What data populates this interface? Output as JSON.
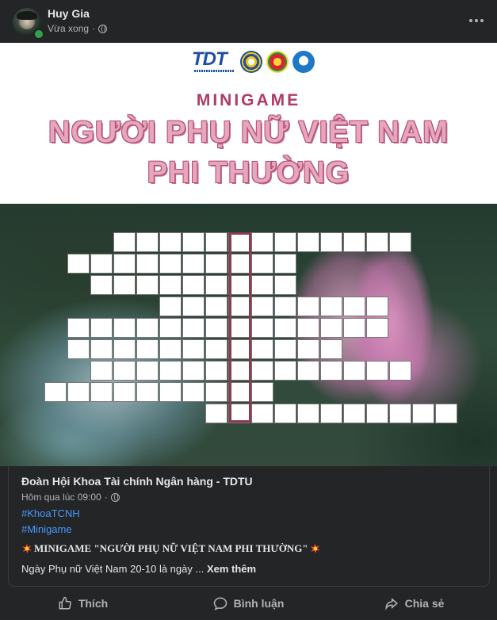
{
  "post": {
    "author": "Huy Gia",
    "time": "Vừa xong",
    "separator": "·"
  },
  "banner": {
    "logo_text": "TDT",
    "minigame_label": "MINIGAME",
    "title_line_1": "NGƯỜI PHỤ NỮ VIỆT NAM",
    "title_line_2": "PHI THƯỜNG"
  },
  "shared_card": {
    "page_name": "Đoàn Hội Khoa Tài chính Ngân hàng - TDTU",
    "time": "Hôm qua lúc 09:00",
    "separator": "·",
    "hashtags": [
      "#KhoaTCNH",
      "#Minigame"
    ],
    "caption_title": "MINIGAME \"NGƯỜI PHỤ NỮ VIỆT NAM PHI THƯỜNG\"",
    "caption_body": "Ngày Phụ nữ Việt Nam 20-10 là ngày ...",
    "see_more": "Xem thêm"
  },
  "actions": {
    "like": "Thích",
    "comment": "Bình luận",
    "share": "Chia sẻ"
  },
  "icons": [
    "avatar",
    "online-dot",
    "globe-icon",
    "more-icon",
    "spark-icon",
    "like-icon",
    "comment-icon",
    "share-icon"
  ],
  "colors": {
    "background": "#242526",
    "link": "#4599ff",
    "title_pink": "#e6a6bc",
    "title_outline": "#b24e76",
    "key_column": "#8e3a4e"
  }
}
